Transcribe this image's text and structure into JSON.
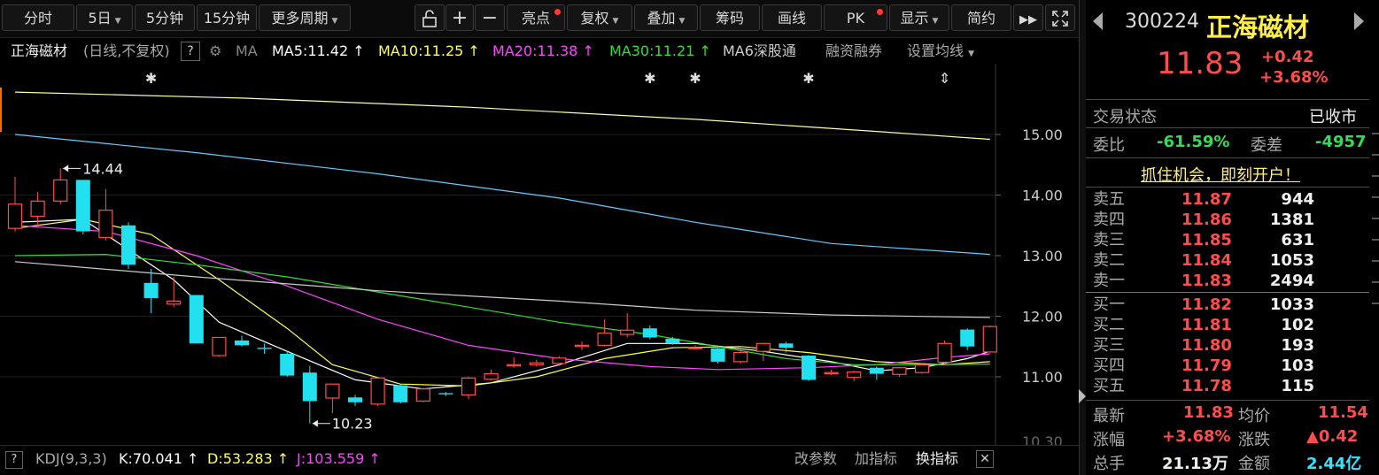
{
  "toolbar": {
    "buttons": [
      {
        "label": "分时",
        "dropdown": false,
        "dot": false
      },
      {
        "label": "5日",
        "dropdown": true,
        "dot": false
      },
      {
        "label": "5分钟",
        "dropdown": false,
        "dot": false
      },
      {
        "label": "15分钟",
        "dropdown": false,
        "dot": false
      },
      {
        "label": "更多周期",
        "dropdown": true,
        "dot": false
      },
      {
        "label": "亮点",
        "dropdown": false,
        "dot": true
      },
      {
        "label": "复权",
        "dropdown": true,
        "dot": false
      },
      {
        "label": "叠加",
        "dropdown": true,
        "dot": false
      },
      {
        "label": "筹码",
        "dropdown": false,
        "dot": false
      },
      {
        "label": "画线",
        "dropdown": false,
        "dot": false
      },
      {
        "label": "PK",
        "dropdown": false,
        "dot": true
      },
      {
        "label": "显示",
        "dropdown": true,
        "dot": false
      },
      {
        "label": "简约",
        "dropdown": false,
        "dot": false
      }
    ],
    "icons": [
      "lock-icon",
      "zoom-in-icon",
      "zoom-out-icon",
      "fast-forward-icon",
      "fullscreen-icon"
    ]
  },
  "info": {
    "name": "正海磁材",
    "period": "(日线,不复权)",
    "help": "?",
    "ma_label": "MA",
    "ma5": "MA5:11.42",
    "ma10": "MA10:11.25",
    "ma20": "MA20:11.38",
    "ma30": "MA30:11.21",
    "ma6": "MA6深股通",
    "rzrq": "融资融券",
    "set_ma": "设置均线",
    "colors": {
      "ma5": "#ffffff",
      "ma10": "#ffff55",
      "ma20": "#ff44ff",
      "ma30": "#33dd33",
      "ma60": "#cccccc"
    }
  },
  "chart_data": {
    "type": "candlestick",
    "y_ticks": [
      "15.00",
      "14.00",
      "13.00",
      "12.00",
      "11.00"
    ],
    "bottom_tick": "10.30",
    "y_axis": {
      "price_top": 15.0,
      "price_bottom": 11.0
    },
    "high_label": "14.44",
    "low_label": "10.23",
    "event_markers": [
      {
        "index": 6,
        "symbol": "✱"
      },
      {
        "index": 28,
        "symbol": "✱"
      },
      {
        "index": 30,
        "symbol": "✱"
      },
      {
        "index": 35,
        "symbol": "✱"
      },
      {
        "index": 41,
        "symbol": "⇕"
      }
    ],
    "candles": [
      {
        "o": 13.45,
        "c": 13.85,
        "h": 14.3,
        "l": 13.4
      },
      {
        "o": 13.65,
        "c": 13.9,
        "h": 14.05,
        "l": 13.5
      },
      {
        "o": 13.9,
        "c": 14.25,
        "h": 14.44,
        "l": 13.85
      },
      {
        "o": 14.25,
        "c": 13.4,
        "h": 14.25,
        "l": 13.35
      },
      {
        "o": 13.3,
        "c": 13.75,
        "h": 14.1,
        "l": 13.25
      },
      {
        "o": 13.5,
        "c": 12.85,
        "h": 13.55,
        "l": 12.78
      },
      {
        "o": 12.55,
        "c": 12.3,
        "h": 12.78,
        "l": 12.05
      },
      {
        "o": 12.2,
        "c": 12.25,
        "h": 12.65,
        "l": 12.15
      },
      {
        "o": 12.35,
        "c": 11.55,
        "h": 12.35,
        "l": 11.55
      },
      {
        "o": 11.35,
        "c": 11.65,
        "h": 11.65,
        "l": 11.33
      },
      {
        "o": 11.6,
        "c": 11.52,
        "h": 11.68,
        "l": 11.5
      },
      {
        "o": 11.48,
        "c": 11.46,
        "h": 11.55,
        "l": 11.38
      },
      {
        "o": 11.38,
        "c": 11.02,
        "h": 11.42,
        "l": 11.0
      },
      {
        "o": 11.07,
        "c": 10.6,
        "h": 11.18,
        "l": 10.23
      },
      {
        "o": 10.65,
        "c": 10.88,
        "h": 10.88,
        "l": 10.4
      },
      {
        "o": 10.66,
        "c": 10.58,
        "h": 10.7,
        "l": 10.52
      },
      {
        "o": 10.55,
        "c": 10.98,
        "h": 11.0,
        "l": 10.52
      },
      {
        "o": 10.86,
        "c": 10.58,
        "h": 10.88,
        "l": 10.56
      },
      {
        "o": 10.6,
        "c": 10.8,
        "h": 10.82,
        "l": 10.58
      },
      {
        "o": 10.73,
        "c": 10.71,
        "h": 10.75,
        "l": 10.68
      },
      {
        "o": 10.7,
        "c": 10.98,
        "h": 11.0,
        "l": 10.63
      },
      {
        "o": 10.96,
        "c": 11.05,
        "h": 11.12,
        "l": 10.94
      },
      {
        "o": 11.18,
        "c": 11.2,
        "h": 11.32,
        "l": 11.15
      },
      {
        "o": 11.2,
        "c": 11.23,
        "h": 11.28,
        "l": 11.17
      },
      {
        "o": 11.22,
        "c": 11.31,
        "h": 11.34,
        "l": 11.18
      },
      {
        "o": 11.5,
        "c": 11.52,
        "h": 11.58,
        "l": 11.44
      },
      {
        "o": 11.52,
        "c": 11.72,
        "h": 11.95,
        "l": 11.5
      },
      {
        "o": 11.7,
        "c": 11.77,
        "h": 12.05,
        "l": 11.65
      },
      {
        "o": 11.8,
        "c": 11.65,
        "h": 11.85,
        "l": 11.62
      },
      {
        "o": 11.63,
        "c": 11.55,
        "h": 11.66,
        "l": 11.53
      },
      {
        "o": 11.48,
        "c": 11.48,
        "h": 11.52,
        "l": 11.45
      },
      {
        "o": 11.47,
        "c": 11.25,
        "h": 11.48,
        "l": 11.22
      },
      {
        "o": 11.25,
        "c": 11.4,
        "h": 11.45,
        "l": 11.22
      },
      {
        "o": 11.42,
        "c": 11.55,
        "h": 11.56,
        "l": 11.26
      },
      {
        "o": 11.55,
        "c": 11.48,
        "h": 11.58,
        "l": 11.4
      },
      {
        "o": 11.35,
        "c": 10.95,
        "h": 11.36,
        "l": 10.93
      },
      {
        "o": 11.05,
        "c": 11.07,
        "h": 11.12,
        "l": 11.03
      },
      {
        "o": 10.99,
        "c": 11.08,
        "h": 11.1,
        "l": 10.93
      },
      {
        "o": 11.15,
        "c": 11.05,
        "h": 11.17,
        "l": 10.95
      },
      {
        "o": 11.04,
        "c": 11.15,
        "h": 11.16,
        "l": 11.0
      },
      {
        "o": 11.07,
        "c": 11.2,
        "h": 11.22,
        "l": 11.05
      },
      {
        "o": 11.24,
        "c": 11.55,
        "h": 11.6,
        "l": 11.2
      },
      {
        "o": 11.78,
        "c": 11.5,
        "h": 11.8,
        "l": 11.44
      },
      {
        "o": 11.41,
        "c": 11.83,
        "h": 11.85,
        "l": 11.4
      }
    ],
    "ma_lines": [
      {
        "name": "MA5",
        "color": "#ffffff",
        "points": [
          [
            0,
            13.55
          ],
          [
            3,
            13.6
          ],
          [
            5,
            13.1
          ],
          [
            7,
            12.6
          ],
          [
            9,
            11.9
          ],
          [
            12,
            11.42
          ],
          [
            15,
            10.95
          ],
          [
            18,
            10.8
          ],
          [
            21,
            10.9
          ],
          [
            24,
            11.2
          ],
          [
            27,
            11.55
          ],
          [
            30,
            11.55
          ],
          [
            33,
            11.42
          ],
          [
            36,
            11.25
          ],
          [
            38,
            11.1
          ],
          [
            40,
            11.15
          ],
          [
            42,
            11.3
          ],
          [
            43,
            11.42
          ]
        ]
      },
      {
        "name": "MA10",
        "color": "#ffff55",
        "points": [
          [
            0,
            13.45
          ],
          [
            3,
            13.6
          ],
          [
            6,
            13.35
          ],
          [
            9,
            12.6
          ],
          [
            12,
            11.8
          ],
          [
            14,
            11.2
          ],
          [
            17,
            10.88
          ],
          [
            20,
            10.85
          ],
          [
            23,
            11.0
          ],
          [
            26,
            11.3
          ],
          [
            29,
            11.48
          ],
          [
            32,
            11.5
          ],
          [
            35,
            11.4
          ],
          [
            38,
            11.25
          ],
          [
            41,
            11.2
          ],
          [
            43,
            11.25
          ]
        ]
      },
      {
        "name": "MA20",
        "color": "#ff44ff",
        "points": [
          [
            0,
            13.5
          ],
          [
            4,
            13.4
          ],
          [
            8,
            13.0
          ],
          [
            12,
            12.5
          ],
          [
            16,
            11.95
          ],
          [
            20,
            11.52
          ],
          [
            24,
            11.3
          ],
          [
            28,
            11.17
          ],
          [
            31,
            11.12
          ],
          [
            35,
            11.15
          ],
          [
            38,
            11.2
          ],
          [
            41,
            11.32
          ],
          [
            43,
            11.38
          ]
        ]
      },
      {
        "name": "MA30",
        "color": "#33dd33",
        "points": [
          [
            0,
            13.0
          ],
          [
            4,
            13.02
          ],
          [
            8,
            12.85
          ],
          [
            12,
            12.65
          ],
          [
            16,
            12.4
          ],
          [
            20,
            12.15
          ],
          [
            24,
            11.9
          ],
          [
            28,
            11.7
          ],
          [
            31,
            11.5
          ],
          [
            34,
            11.3
          ],
          [
            37,
            11.2
          ],
          [
            40,
            11.2
          ],
          [
            43,
            11.21
          ]
        ]
      },
      {
        "name": "MA60",
        "color": "#cccccc",
        "points": [
          [
            0,
            12.9
          ],
          [
            8,
            12.65
          ],
          [
            16,
            12.42
          ],
          [
            24,
            12.25
          ],
          [
            30,
            12.1
          ],
          [
            36,
            12.02
          ],
          [
            43,
            11.98
          ]
        ]
      },
      {
        "name": "MA120",
        "color": "#66ccff",
        "points": [
          [
            0,
            15.0
          ],
          [
            8,
            14.7
          ],
          [
            16,
            14.35
          ],
          [
            24,
            13.95
          ],
          [
            30,
            13.55
          ],
          [
            36,
            13.2
          ],
          [
            43,
            13.02
          ]
        ]
      },
      {
        "name": "MA250",
        "color": "#ffffaa",
        "points": [
          [
            0,
            15.7
          ],
          [
            10,
            15.6
          ],
          [
            20,
            15.45
          ],
          [
            30,
            15.25
          ],
          [
            38,
            15.05
          ],
          [
            43,
            14.92
          ]
        ]
      }
    ]
  },
  "kdj": {
    "help": "?",
    "name": "KDJ(9,3,3)",
    "k": "K:70.041",
    "d": "D:53.283",
    "j": "J:103.559",
    "btn_params": "改参数",
    "btn_add": "加指标",
    "btn_switch": "换指标"
  },
  "right": {
    "code": "300224",
    "name": "正海磁材",
    "price": "11.83",
    "change": "+0.42",
    "change_pct": "+3.68%",
    "status_label": "交易状态",
    "status_value": "已收市",
    "wb_label": "委比",
    "wb_value": "-61.59%",
    "wc_label": "委差",
    "wc_value": "-4957",
    "promo": "抓住机会，即刻开户！",
    "asks": [
      {
        "label": "卖五",
        "price": "11.87",
        "vol": "944"
      },
      {
        "label": "卖四",
        "price": "11.86",
        "vol": "1381"
      },
      {
        "label": "卖三",
        "price": "11.85",
        "vol": "631"
      },
      {
        "label": "卖二",
        "price": "11.84",
        "vol": "1053"
      },
      {
        "label": "卖一",
        "price": "11.83",
        "vol": "2494"
      }
    ],
    "bids": [
      {
        "label": "买一",
        "price": "11.82",
        "vol": "1033"
      },
      {
        "label": "买二",
        "price": "11.81",
        "vol": "102"
      },
      {
        "label": "买三",
        "price": "11.80",
        "vol": "193"
      },
      {
        "label": "买四",
        "price": "11.79",
        "vol": "103"
      },
      {
        "label": "买五",
        "price": "11.78",
        "vol": "115"
      }
    ],
    "stats": {
      "latest_label": "最新",
      "latest": "11.83",
      "avg_label": "均价",
      "avg": "11.54",
      "pct_label": "涨幅",
      "pct": "+3.68%",
      "chg_label": "涨跌",
      "chg": "▲0.42",
      "vol_label": "总手",
      "vol": "21.13万",
      "amt_label": "金额",
      "amt": "2.44亿"
    }
  }
}
